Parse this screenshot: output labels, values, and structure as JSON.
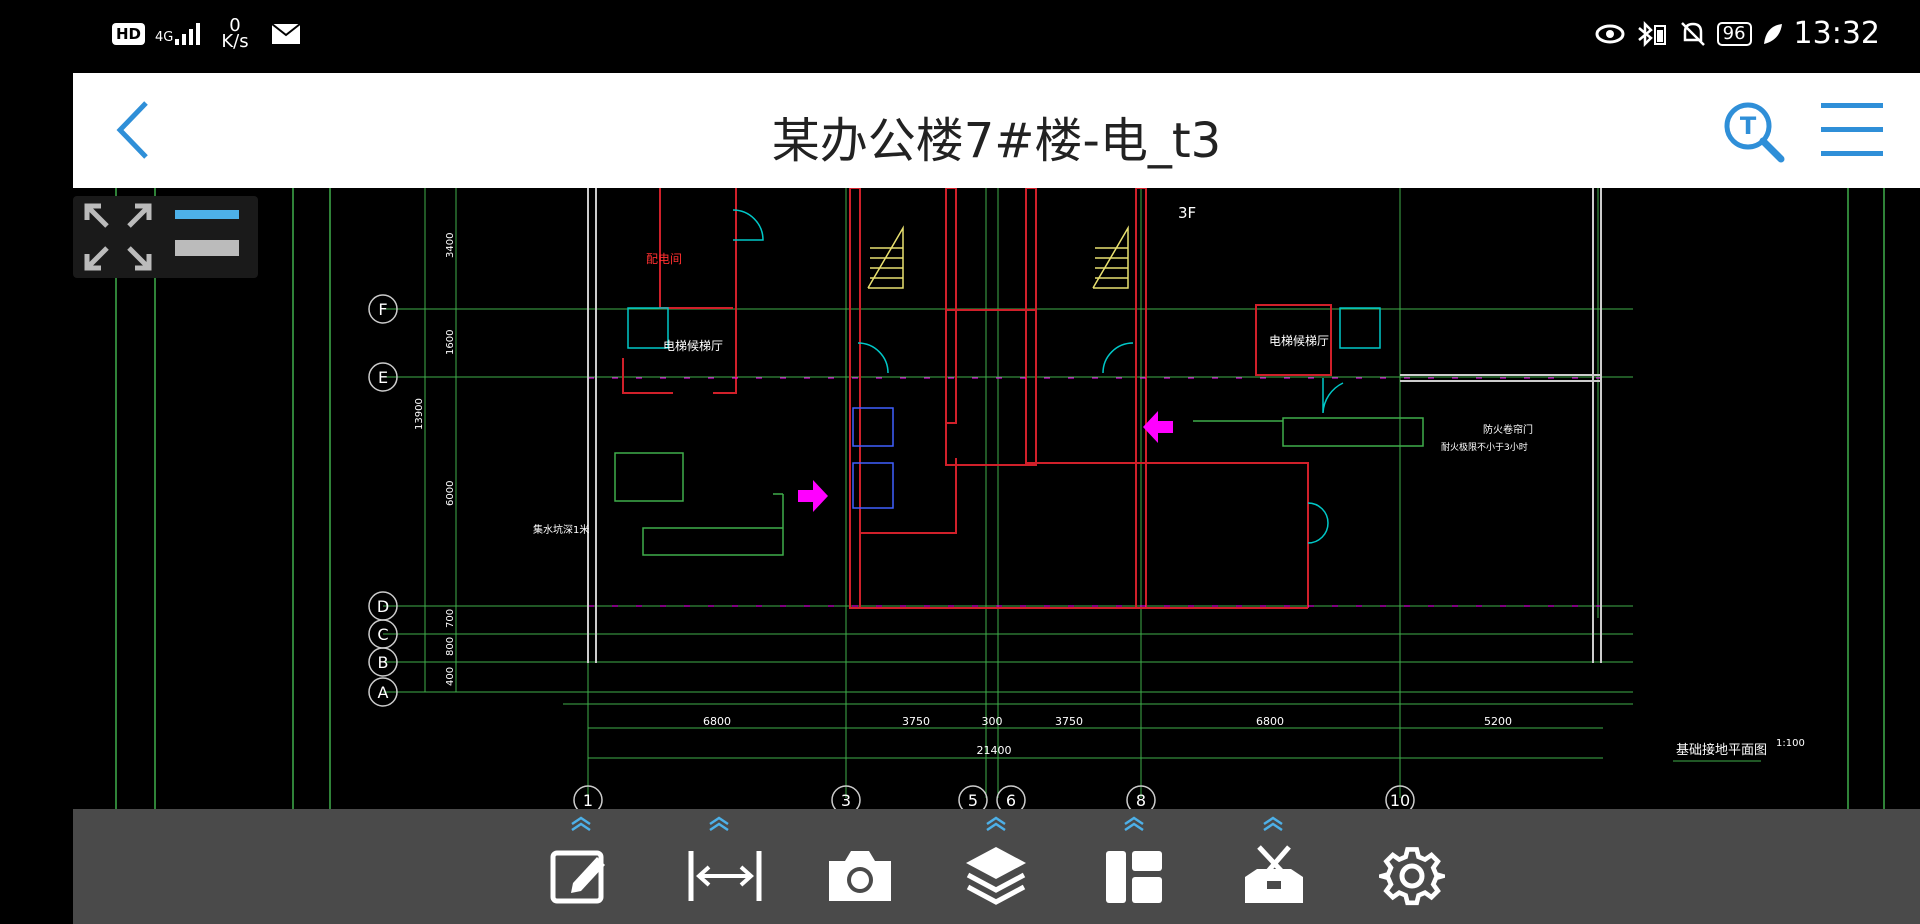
{
  "status": {
    "hd": "HD",
    "signal": "4G",
    "speed_value": "0",
    "speed_unit": "K/s",
    "battery": "96",
    "time": "13:32"
  },
  "header": {
    "title": "某办公楼7#楼-电_t3"
  },
  "drawing": {
    "floor_label": "3F",
    "axes_rows": [
      "F",
      "E",
      "D",
      "C",
      "B",
      "A"
    ],
    "axes_cols": [
      "1",
      "3",
      "5",
      "6",
      "8",
      "10"
    ],
    "row_dims": [
      "3400",
      "1600",
      "6000",
      "700",
      "800",
      "400"
    ],
    "total_row_dim": "13900",
    "col_dims": [
      "6800",
      "3750",
      "300",
      "3750",
      "6800",
      "5200"
    ],
    "total_col_dim": "21400",
    "room_labels": [
      "配电间",
      "电梯候梯厅",
      "电梯候梯厅",
      "防火卷帘门",
      "耐火极限不小于3小时",
      "集水坑深1米"
    ],
    "plan_title": "基础接地平面图",
    "plan_scale": "1:100"
  },
  "toolbar": {
    "tools": [
      "edit-tool",
      "measure-tool",
      "camera-tool",
      "layers-tool",
      "layout-tool",
      "toolbox-tool",
      "settings-tool"
    ]
  },
  "colors": {
    "accent": "#2f8fd8",
    "toolbar_bg": "#4a4a4a",
    "cad_green": "#3fae4a",
    "cad_red": "#d0202a",
    "cad_magenta": "#ff00ff",
    "cad_cyan": "#00c8c8",
    "cad_yellow": "#e8e070"
  }
}
